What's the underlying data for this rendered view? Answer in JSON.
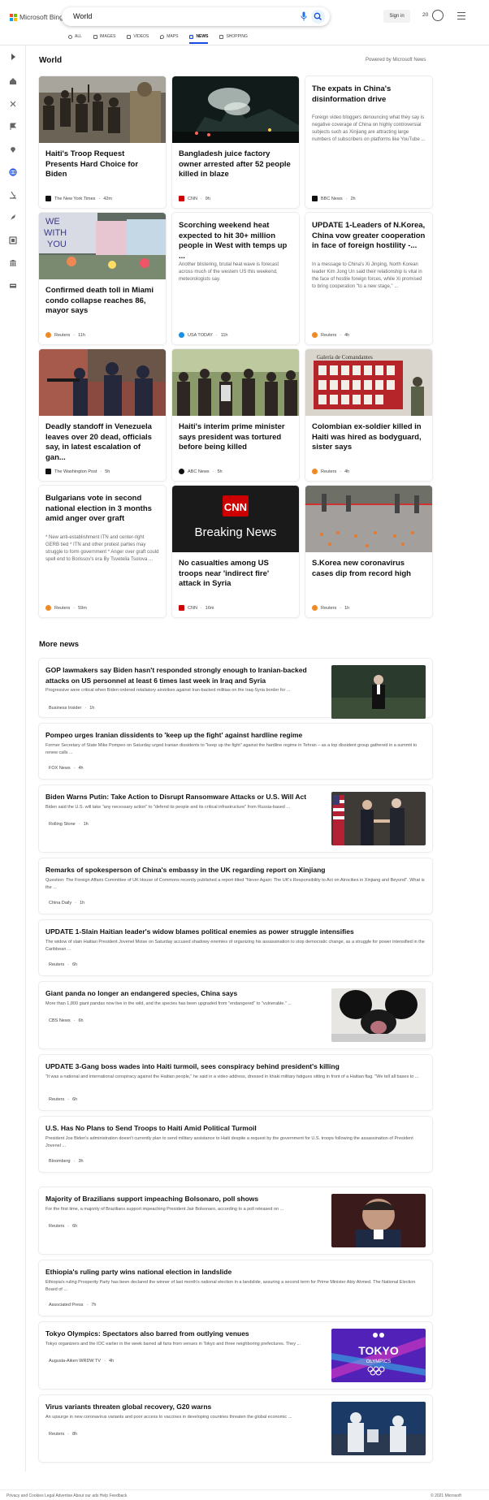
{
  "header": {
    "logo_text": "Microsoft Bing",
    "search_query": "World",
    "sign_in": "Sign in",
    "points": "20",
    "tabs": [
      {
        "label": "ALL",
        "icon": "search-icon"
      },
      {
        "label": "IMAGES",
        "icon": "image-icon"
      },
      {
        "label": "VIDEOS",
        "icon": "video-icon"
      },
      {
        "label": "MAPS",
        "icon": "map-icon"
      },
      {
        "label": "NEWS",
        "icon": "news-icon",
        "active": true
      },
      {
        "label": "SHOPPING",
        "icon": "shopping-icon"
      }
    ]
  },
  "sidebar": {
    "icons": [
      "expand-arrow-icon",
      "home-icon",
      "science-icon",
      "flag-icon",
      "location-icon",
      "globe-icon",
      "microscope-icon",
      "rocket-icon",
      "entertainment-icon",
      "government-icon",
      "money-icon"
    ]
  },
  "main": {
    "title": "World",
    "powered_by": "Powered by Microsoft News"
  },
  "cards": [
    {
      "title": "Haiti's Troop Request Presents Hard Choice for Biden",
      "desc": "",
      "source": "The New York Times",
      "time": "42m",
      "source_color": "#111111"
    },
    {
      "title": "Bangladesh juice factory owner arrested after 52 people killed in blaze",
      "desc": "",
      "source": "CNN",
      "time": "9h",
      "source_color": "#cc0000"
    },
    {
      "title": "The expats in China's disinformation drive",
      "desc": "Foreign video bloggers denouncing what they say is negative coverage of China on highly controversial subjects such as Xinjiang are attracting large numbers of subscribers on platforms like YouTube ...",
      "source": "BBC News",
      "time": "2h",
      "source_color": "#111111"
    },
    {
      "title": "Confirmed death toll in Miami condo collapse reaches 86, mayor says",
      "desc": "",
      "source": "Reuters",
      "time": "11h",
      "source_color": "#f08a24"
    },
    {
      "title": "Scorching weekend heat expected to hit 30+ million people in West with temps up ...",
      "desc": "Another blistering, brutal heat wave is forecast across much of the western US this weekend, meteorologists say.",
      "source": "USA TODAY",
      "time": "11h",
      "source_color": "#1a8fe3"
    },
    {
      "title": "UPDATE 1-Leaders of N.Korea, China vow greater cooperation in face of foreign hostility -...",
      "desc": "In a message to China's Xi Jinping, North Korean leader Kim Jong Un said their relationship is vital in the face of hostile foreign forces, while Xi promised to bring cooperation \"to a new stage,\" ...",
      "source": "Reuters",
      "time": "4h",
      "source_color": "#f08a24"
    },
    {
      "title": "Deadly standoff in Venezuela leaves over 20 dead, officials say, in latest escalation of gan...",
      "desc": "",
      "source": "The Washington Post",
      "time": "5h",
      "source_color": "#111111"
    },
    {
      "title": "Haiti's interim prime minister says president was tortured before being killed",
      "desc": "",
      "source": "ABC News",
      "time": "5h",
      "source_color": "#111111"
    },
    {
      "title": "Colombian ex-soldier killed in Haiti was hired as bodyguard, sister says",
      "desc": "",
      "source": "Reuters",
      "time": "4h",
      "source_color": "#f08a24"
    },
    {
      "title": "Bulgarians vote in second national election in 3 months amid anger over graft",
      "desc": "* New anti-establishment ITN and center-right GERB tied * ITN and other protest parties may struggle to form government * Anger over graft could spell end to Borissov's era By Tsvetelia Tsolova ...",
      "source": "Reuters",
      "time": "59m",
      "source_color": "#f08a24"
    },
    {
      "title": "No casualties among US troops near 'indirect fire' attack in Syria",
      "desc": "",
      "source": "CNN",
      "time": "16m",
      "source_color": "#cc0000",
      "image_text_1": "CNN",
      "image_text_2": "Breaking News"
    },
    {
      "title": "S.Korea new coronavirus cases dip from record high",
      "desc": "",
      "source": "Reuters",
      "time": "1h",
      "source_color": "#f08a24"
    }
  ],
  "image_text": {
    "gallery_sign": "Galería de Comandantes",
    "sign_we": "WE",
    "sign_with": "WITH",
    "sign_you": "YOU",
    "tokyo": "TOKYO",
    "olympics": "OLYMPICS"
  },
  "more_news": {
    "title": "More news",
    "items": [
      {
        "title": "GOP lawmakers say Biden hasn't responded strongly enough to Iranian-backed attacks on US personnel at least 6 times last week in Iraq and Syria",
        "desc": "Progressive were critical when Biden ordered retaliatory airstrikes against Iran-backed militias on the Iraq-Syria border for ...",
        "source": "Business Insider",
        "time": "1h",
        "source_color": "#1a5ce5"
      },
      {
        "title": "Pompeo urges Iranian dissidents to 'keep up the fight' against hardline regime",
        "desc": "Former Secretary of State Mike Pompeo on Saturday urged Iranian dissidents to \"keep up the fight\" against the hardline regime in Tehran – as a top dissident group gathered in a summit to renew calls ...",
        "source": "FOX News",
        "time": "4h",
        "source_color": "#003366"
      },
      {
        "title": "Biden Warns Putin: Take Action to Disrupt Ransomware Attacks or U.S. Will Act",
        "desc": "Biden said the U.S. will take \"any necessary action\" to \"defend its people and its critical infrastructure\" from Russia-based ...",
        "source": "Rolling Stone",
        "time": "1h",
        "source_color": "#d0021b"
      },
      {
        "title": "Remarks of spokesperson of China's embassy in the UK regarding report on Xinjiang",
        "desc": "Question: The Foreign Affairs Committee of UK House of Commons recently published a report titled \"Never Again: The UK's Responsibility to Act on Atrocities in Xinjiang and Beyond\". What is the ...",
        "source": "China Daily",
        "time": "1h",
        "source_color": "#111111"
      },
      {
        "title": "UPDATE 1-Slain Haitian leader's widow blames political enemies as power struggle intensifies",
        "desc": "The widow of slain Haitian President Jovenel Moise on Saturday accused shadowy enemies of organizing his assassination to stop democratic change, as a struggle for power intensified in the Caribbean ...",
        "source": "Reuters",
        "time": "6h",
        "source_color": "#f08a24"
      },
      {
        "title": "Giant panda no longer an endangered species, China says",
        "desc": "More than 1,800 giant pandas now live in the wild, and the species has been upgraded from \"endangered\" to \"vulnerable.\" ...",
        "source": "CBS News",
        "time": "6h",
        "source_color": "#111111"
      },
      {
        "title": "UPDATE 3-Gang boss wades into Haiti turmoil, sees conspiracy behind president's killing",
        "desc": "\"It was a national and international conspiracy against the Haitian people,\" he said in a video address, dressed in khaki military fatigues sitting in front of a Haitian flag. \"We tell all bases to ...",
        "source": "Reuters",
        "time": "6h",
        "source_color": "#f08a24"
      },
      {
        "title": "U.S. Has No Plans to Send Troops to Haiti Amid Political Turmoil",
        "desc": "President Joe Biden's administration doesn't currently plan to send military assistance to Haiti despite a request by the government for U.S. troops following the assassination of President Jovenel ...",
        "source": "Bloomberg",
        "time": "3h",
        "source_color": "#4a00e0"
      },
      {
        "title": "Majority of Brazilians support impeaching Bolsonaro, poll shows",
        "desc": "For the first time, a majority of Brazilians support impeaching President Jair Bolsonaro, according to a poll released on ...",
        "source": "Reuters",
        "time": "6h",
        "source_color": "#f08a24"
      },
      {
        "title": "Ethiopia's ruling party wins national election in landslide",
        "desc": "Ethiopia's ruling Prosperity Party has been declared the winner of last month's national election in a landslide, assuring a second term for Prime Minister Abiy Ahmed. The National Election Board of ...",
        "source": "Associated Press",
        "time": "7h",
        "source_color": "#d0021b"
      },
      {
        "title": "Tokyo Olympics: Spectators also barred from outlying venues",
        "desc": "Tokyo organizers and the IOC earlier in the week barred all fans from venues in Tokyo and three neighboring prefectures. They ...",
        "source": "Augusta-Aiken WRDW TV",
        "time": "4h",
        "source_color": "#5b3fd6"
      },
      {
        "title": "Virus variants threaten global recovery, G20 warns",
        "desc": "An upsurge in new coronavirus variants and poor access to vaccines in developing countries threaten the global economic ...",
        "source": "Reuters",
        "time": "8h",
        "source_color": "#f08a24"
      }
    ]
  },
  "footer": {
    "left": "Privacy and Cookies   Legal   Advertise   About our ads   Help   Feedback",
    "right": "© 2021 Microsoft"
  }
}
